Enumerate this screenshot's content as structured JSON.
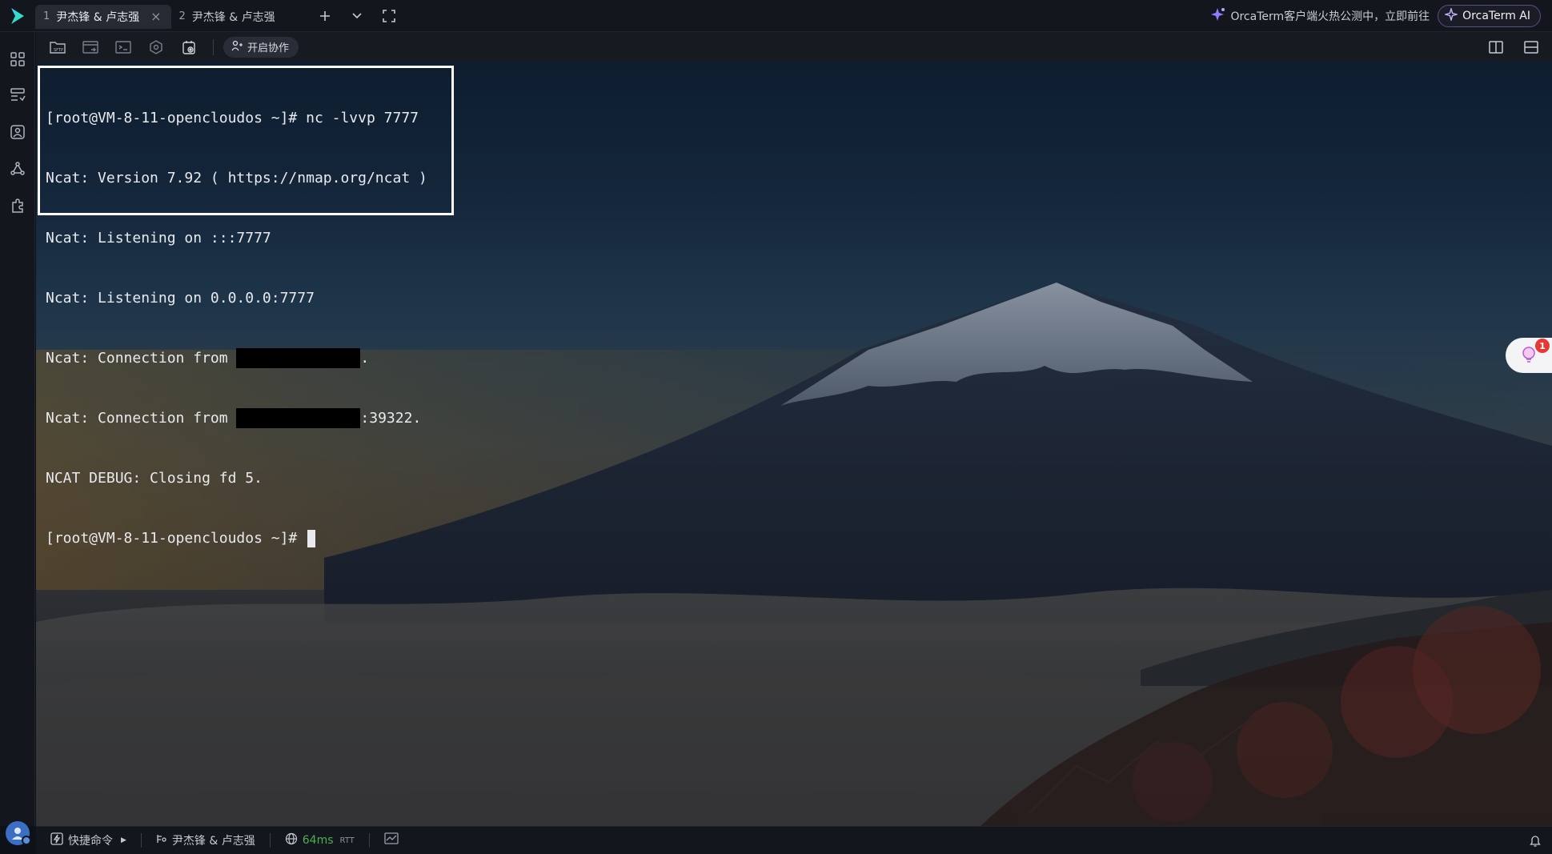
{
  "tabs": [
    {
      "num": "1",
      "label": "尹杰锋 & 卢志强",
      "active": true
    },
    {
      "num": "2",
      "label": "尹杰锋 & 卢志强",
      "active": false
    }
  ],
  "topbar": {
    "promo_text": "OrcaTerm客户端火热公测中，立即前往",
    "ai_button": "OrcaTerm AI"
  },
  "toolbar": {
    "collab_label": "开启协作",
    "tools": [
      "sftp-icon",
      "file-transfer-icon",
      "terminal-icon",
      "settings-icon",
      "screen-record-icon"
    ]
  },
  "terminal": {
    "lines": [
      "[root@VM-8-11-opencloudos ~]# nc -lvvp 7777",
      "Ncat: Version 7.92 ( https://nmap.org/ncat )",
      "Ncat: Listening on :::7777",
      "Ncat: Listening on 0.0.0.0:7777",
      "NCAT DEBUG: Closing fd 5."
    ],
    "conn1_prefix": "Ncat: Connection from ",
    "conn1_suffix": ".",
    "conn2_prefix": "Ncat: Connection from ",
    "conn2_suffix": ":39322.",
    "prompt": "[root@VM-8-11-opencloudos ~]# "
  },
  "assistant": {
    "badge": "1"
  },
  "statusbar": {
    "quick_cmd": "快捷命令",
    "session": "尹杰锋 & 卢志强",
    "latency": "64ms",
    "rtt_label": "RTT"
  },
  "colors": {
    "accent_purple": "#7b5cff",
    "latency_green": "#4caf50",
    "badge_red": "#e53935"
  }
}
